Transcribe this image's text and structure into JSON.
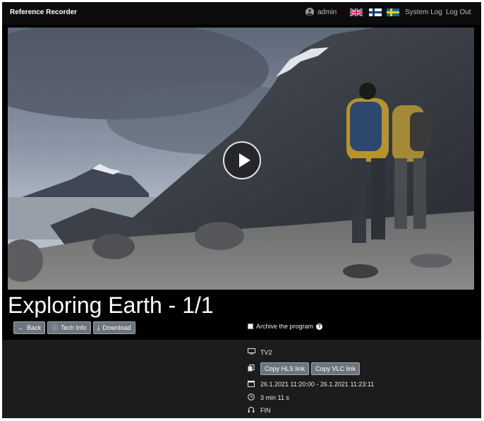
{
  "app": {
    "brand": "Reference Recorder"
  },
  "nav": {
    "user": "admin",
    "flags": [
      "uk-flag",
      "finland-flag",
      "sweden-flag"
    ],
    "system_log": "System Log",
    "logout": "Log Out"
  },
  "program": {
    "title": "Exploring Earth - 1/1",
    "buttons": {
      "back": "Back",
      "tech_info": "Tech Info",
      "download": "Download"
    },
    "archive_label": "Archive the program",
    "channel": "TV2",
    "copy_hls": "Copy HLS link",
    "copy_vlc": "Copy VLC link",
    "time_range": "26.1.2021 11:20:00 - 26.1.2021 11:23:11",
    "duration": "3 min 11 s",
    "language": "FIN"
  },
  "colors": {
    "navbar": "#0c0c0c",
    "panel": "#1c1c1c",
    "button": "#6c757d"
  }
}
